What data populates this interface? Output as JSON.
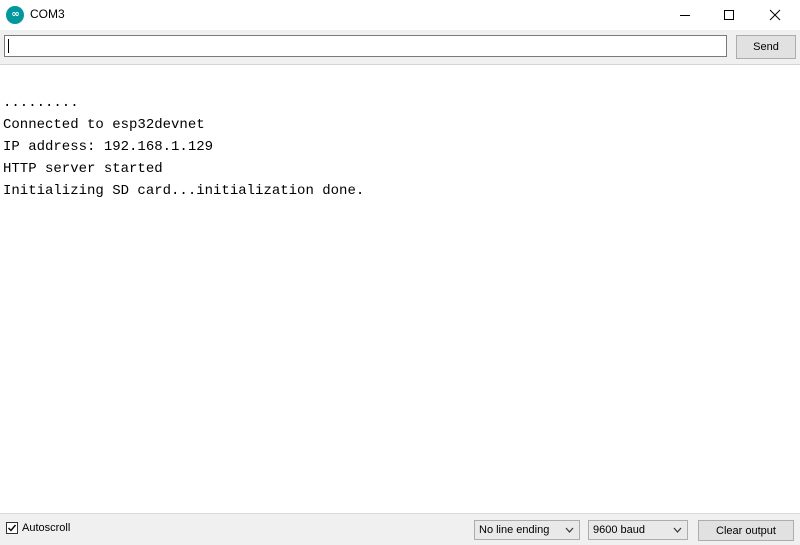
{
  "window": {
    "title": "COM3",
    "app_icon_text": "∞"
  },
  "send_bar": {
    "input_value": "",
    "send_label": "Send"
  },
  "console": {
    "lines": [
      ".........",
      "Connected to esp32devnet",
      "IP address: 192.168.1.129",
      "HTTP server started",
      "Initializing SD card...initialization done."
    ]
  },
  "statusbar": {
    "autoscroll_label": "Autoscroll",
    "autoscroll_checked": true,
    "line_ending": "No line ending",
    "baud_rate": "9600 baud",
    "clear_label": "Clear output"
  },
  "colors": {
    "app_icon": "#00979d",
    "bar_background": "#f0f0f0"
  }
}
